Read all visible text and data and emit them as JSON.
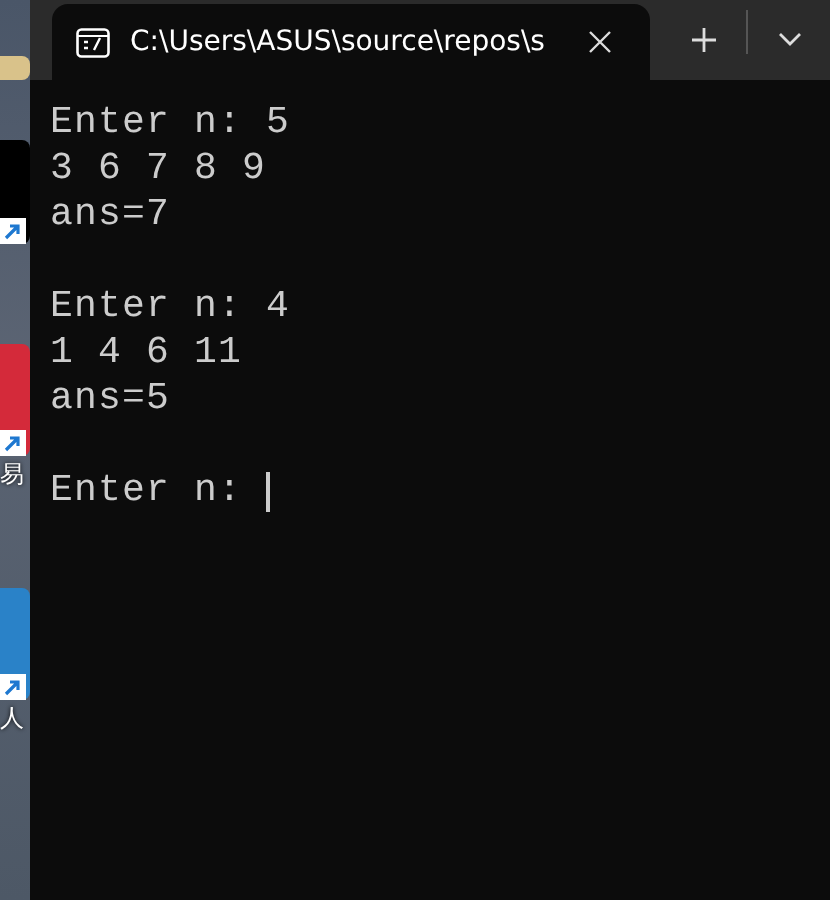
{
  "desktop": {
    "icons": [
      {
        "kind": "small"
      },
      {
        "kind": "dark"
      },
      {
        "kind": "red",
        "label": "易"
      },
      {
        "kind": "blue",
        "label": "人"
      }
    ]
  },
  "window": {
    "tab": {
      "title": "C:\\Users\\ASUS\\source\\repos\\s",
      "selected": true
    }
  },
  "terminal": {
    "runs": [
      {
        "prompt": "Enter n: 5",
        "input": "3 6 7 8 9",
        "result": "ans=7"
      },
      {
        "prompt": "Enter n: 4",
        "input": "1 4 6 11",
        "result": "ans=5"
      }
    ],
    "current_prompt": "Enter n:",
    "cursor": true
  }
}
